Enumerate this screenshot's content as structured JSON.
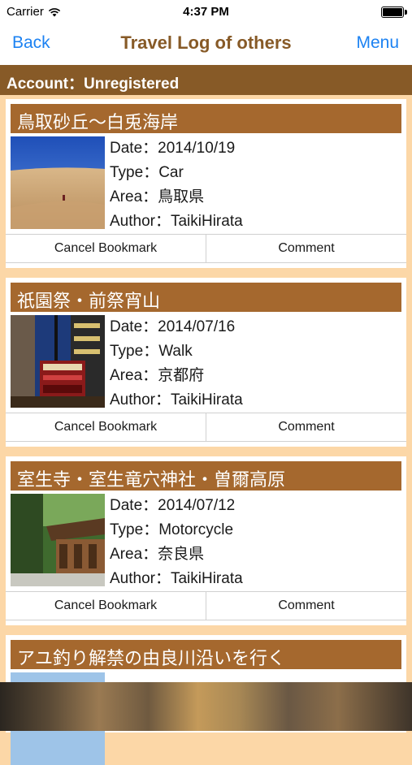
{
  "status_bar": {
    "carrier": "Carrier",
    "time": "4:37 PM"
  },
  "nav": {
    "back_label": "Back",
    "title": "Travel Log of others",
    "menu_label": "Menu"
  },
  "account": {
    "text": "Account：Unregistered"
  },
  "logs": [
    {
      "title": "鳥取砂丘〜白兎海岸",
      "date": "Date：2014/10/19",
      "type": "Type：Car",
      "area": "Area：鳥取県",
      "author": "Author：TaikiHirata",
      "cancel_label": "Cancel Bookmark",
      "comment_label": "Comment"
    },
    {
      "title": "祇園祭・前祭宵山",
      "date": "Date：2014/07/16",
      "type": "Type：Walk",
      "area": "Area：京都府",
      "author": "Author：TaikiHirata",
      "cancel_label": "Cancel Bookmark",
      "comment_label": "Comment"
    },
    {
      "title": "室生寺・室生竜穴神社・曽爾高原",
      "date": "Date：2014/07/12",
      "type": "Type：Motorcycle",
      "area": "Area：奈良県",
      "author": "Author：TaikiHirata",
      "cancel_label": "Cancel Bookmark",
      "comment_label": "Comment"
    },
    {
      "title": "アユ釣り解禁の由良川沿いを行く"
    }
  ]
}
